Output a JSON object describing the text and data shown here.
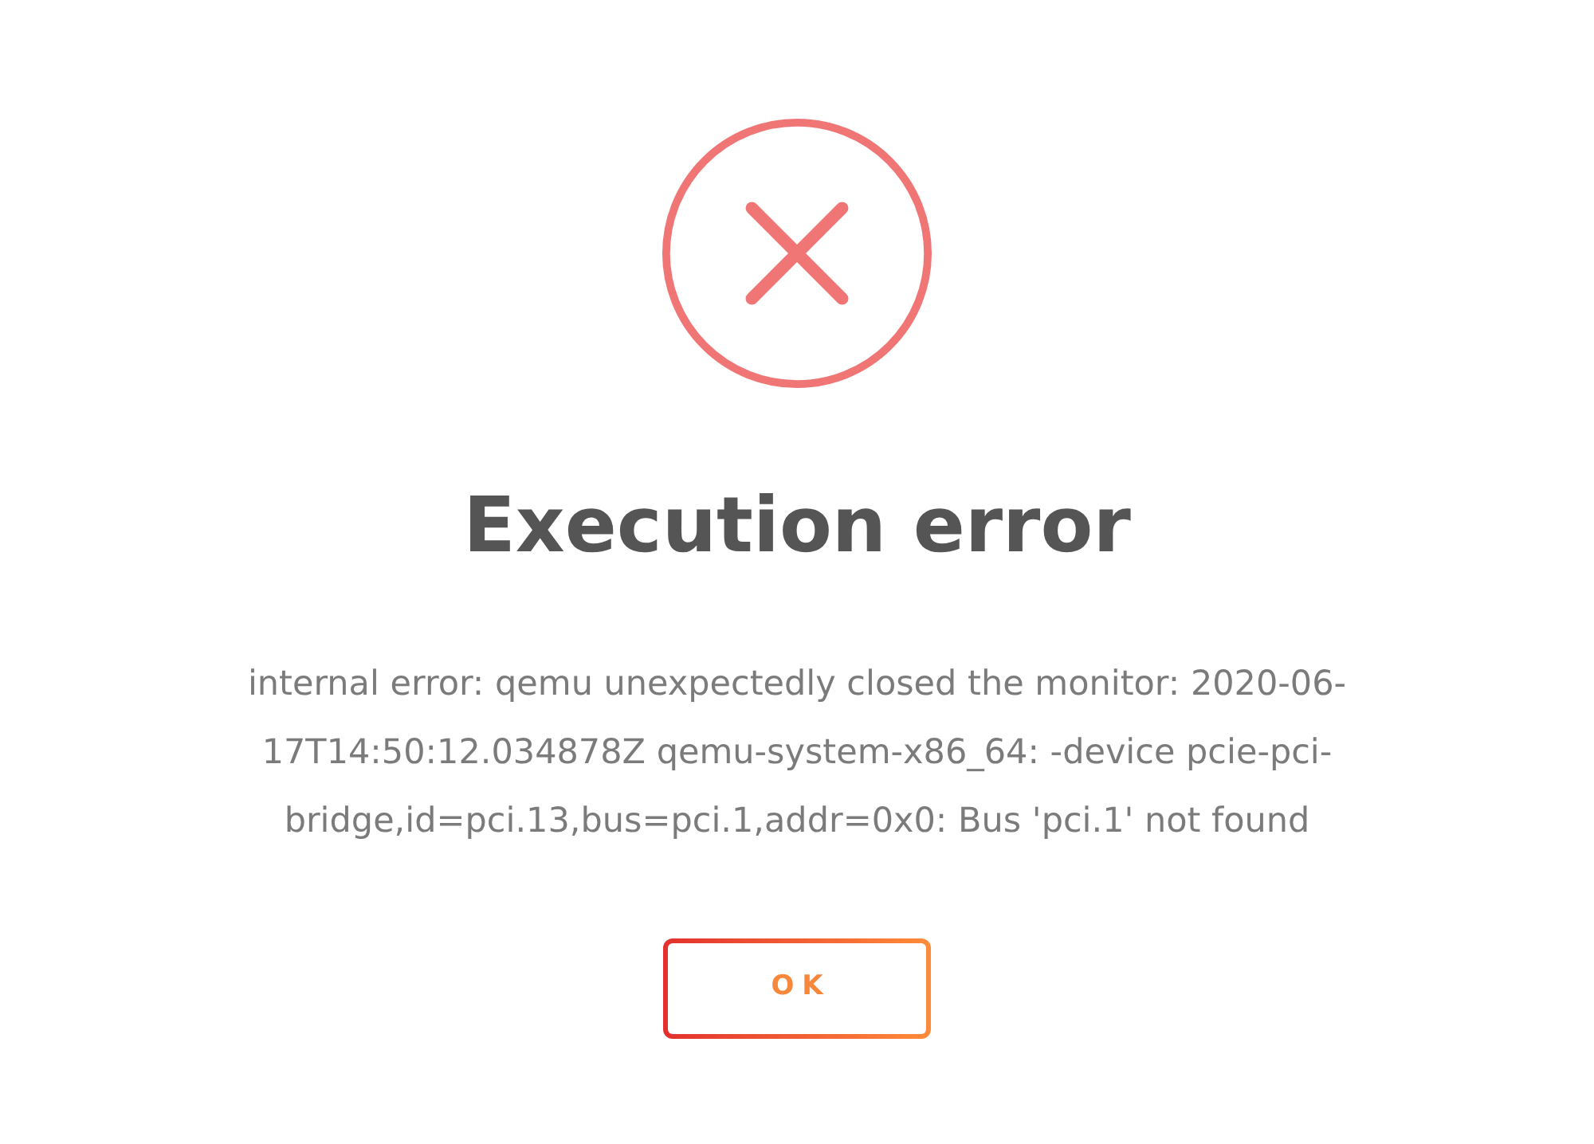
{
  "dialog": {
    "title": "Execution error",
    "message": "internal error: qemu unexpectedly closed the monitor: 2020-06-17T14:50:12.034878Z qemu-system-x86_64: -device pcie-pci-bridge,id=pci.13,bus=pci.1,addr=0x0: Bus 'pci.1' not found",
    "buttons": [
      "OK"
    ]
  }
}
